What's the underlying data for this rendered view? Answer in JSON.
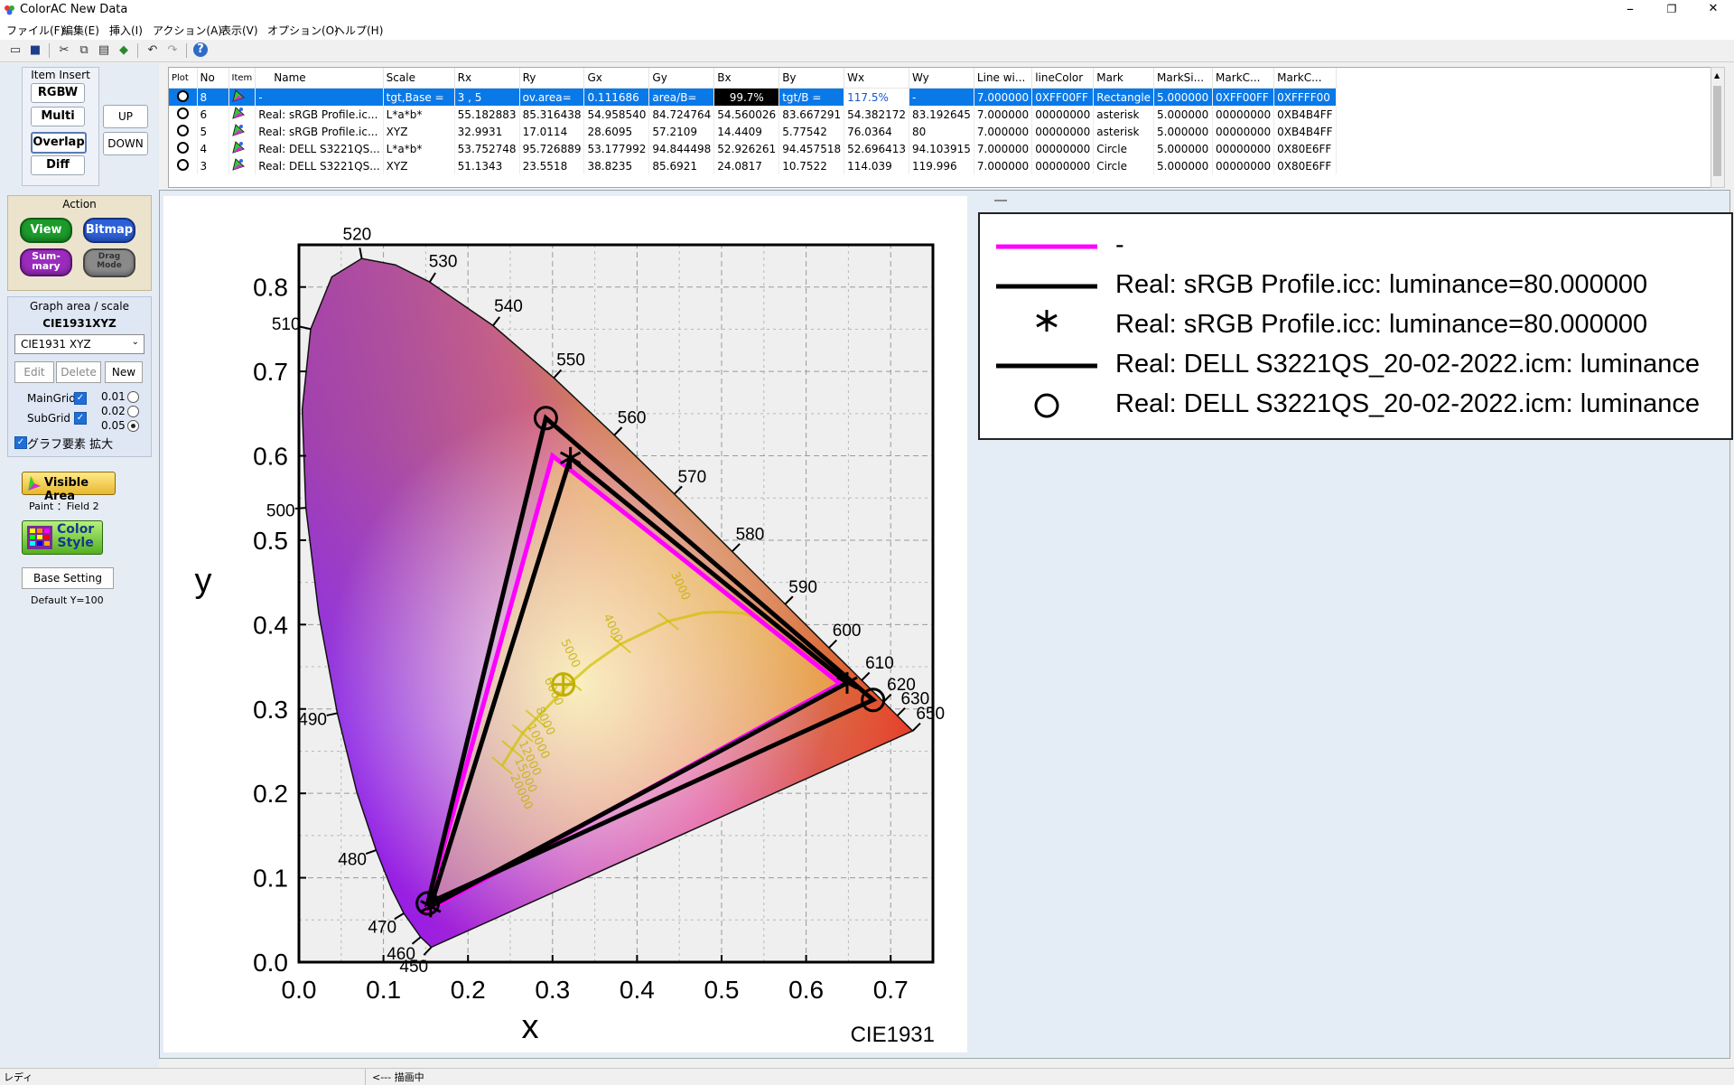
{
  "app": {
    "title": "ColorAC  New Data",
    "icon_letters": "AC"
  },
  "window_buttons": {
    "minimize": "–",
    "maximize": "❐",
    "close": "✕"
  },
  "menu": [
    "ファイル(F)",
    "編集(E)",
    "挿入(I)",
    "アクション(A)",
    "表示(V)",
    "オプション(O)",
    "ヘルプ(H)"
  ],
  "left": {
    "item_insert": {
      "title": "Item Insert",
      "rgbw": "RGBW",
      "multi": "Multi",
      "overlap": "Overlap",
      "diff": "Diff",
      "up": "UP",
      "down": "DOWN"
    },
    "action": {
      "title": "Action",
      "view": "View",
      "bitmap": "Bitmap",
      "summary_1": "Sum-",
      "summary_2": "mary",
      "drag_1": "Drag",
      "drag_2": "Mode"
    },
    "graph": {
      "title": "Graph area / scale",
      "current": "CIE1931XYZ",
      "select_value": "CIE1931 XYZ",
      "edit": "Edit",
      "delete": "Delete",
      "new": "New",
      "maingrid": "MainGrid",
      "subgrid": "SubGrid",
      "opt1": "0.01",
      "opt2": "0.02",
      "opt3": "0.05",
      "enlarge": "グラフ要素 拡大"
    },
    "visible_area": "Visible Area",
    "paint": "Paint ：Field 2",
    "color_style_1": "Color",
    "color_style_2": "Style",
    "base_setting": "Base Setting",
    "default_y": "Default Y=100"
  },
  "table": {
    "headers": [
      "Plot",
      "No",
      "Item",
      "Name",
      "Scale",
      "Rx",
      "Ry",
      "Gx",
      "Gy",
      "Bx",
      "By",
      "Wx",
      "Wy",
      "Line wi...",
      "lineColor",
      "Mark",
      "MarkSi...",
      "MarkC...",
      "MarkC..."
    ],
    "rows": [
      [
        "",
        "8",
        "",
        "-",
        "tgt,Base =",
        "3 , 5",
        "ov.area=",
        "0.111686",
        "area/B=",
        "99.7%",
        "tgt/B =",
        "117.5%",
        "-",
        "7.000000",
        "0XFF00FF",
        "Rectangle",
        "5.000000",
        "0XFF00FF",
        "0XFFFF00"
      ],
      [
        "",
        "6",
        "",
        "Real: sRGB Profile.ic...",
        "L*a*b*",
        "55.182883",
        "85.316438",
        "54.958540",
        "84.724764",
        "54.560026",
        "83.667291",
        "54.382172",
        "83.192645",
        "7.000000",
        "00000000",
        "asterisk",
        "5.000000",
        "00000000",
        "0XB4B4FF"
      ],
      [
        "",
        "5",
        "",
        "Real: sRGB Profile.ic...",
        "XYZ",
        "32.9931",
        "17.0114",
        "28.6095",
        "57.2109",
        "14.4409",
        "5.77542",
        "76.0364",
        "80",
        "7.000000",
        "00000000",
        "asterisk",
        "5.000000",
        "00000000",
        "0XB4B4FF"
      ],
      [
        "",
        "4",
        "",
        "Real: DELL S3221QS...",
        "L*a*b*",
        "53.752748",
        "95.726889",
        "53.177992",
        "94.844498",
        "52.926261",
        "94.457518",
        "52.696413",
        "94.103915",
        "7.000000",
        "00000000",
        "Circle",
        "5.000000",
        "00000000",
        "0X80E6FF"
      ],
      [
        "",
        "3",
        "",
        "Real: DELL S3221QS...",
        "XYZ",
        "51.1343",
        "23.5518",
        "38.8235",
        "85.6921",
        "24.0817",
        "10.7522",
        "114.039",
        "119.996",
        "7.000000",
        "00000000",
        "Circle",
        "5.000000",
        "00000000",
        "0X80E6FF"
      ]
    ]
  },
  "legend": {
    "entries": [
      {
        "text": "-",
        "color": "#ff00ff",
        "marker": "line"
      },
      {
        "text": "Real: sRGB Profile.icc: luminance=80.000000",
        "color": "#000000",
        "marker": "line"
      },
      {
        "text": "Real: sRGB Profile.icc: luminance=80.000000",
        "color": "#000000",
        "marker": "asterisk"
      },
      {
        "text": "Real: DELL S3221QS_20-02-2022.icm: luminance",
        "color": "#000000",
        "marker": "line"
      },
      {
        "text": "Real: DELL S3221QS_20-02-2022.icm: luminance",
        "color": "#000000",
        "marker": "circle"
      }
    ]
  },
  "status": {
    "left": "レディ",
    "right": "<--- 描画中"
  },
  "chart_data": {
    "type": "scatter",
    "caption": "CIE1931",
    "xlabel": "x",
    "ylabel": "y",
    "xlim": [
      0.0,
      0.75
    ],
    "ylim": [
      0.0,
      0.85
    ],
    "xticks": [
      "0.0",
      "0.1",
      "0.2",
      "0.3",
      "0.4",
      "0.5",
      "0.6",
      "0.7"
    ],
    "yticks": [
      "0.0",
      "0.1",
      "0.2",
      "0.3",
      "0.4",
      "0.5",
      "0.6",
      "0.7",
      "0.8"
    ],
    "grid": true,
    "spectral_locus": [
      {
        "nm": 450,
        "x": 0.1566,
        "y": 0.0177
      },
      {
        "nm": 460,
        "x": 0.144,
        "y": 0.0297
      },
      {
        "nm": 470,
        "x": 0.1241,
        "y": 0.0578
      },
      {
        "nm": 475,
        "x": 0.1096,
        "y": 0.0868
      },
      {
        "nm": 480,
        "x": 0.0913,
        "y": 0.1327
      },
      {
        "nm": 485,
        "x": 0.0687,
        "y": 0.2007
      },
      {
        "nm": 490,
        "x": 0.0454,
        "y": 0.295
      },
      {
        "nm": 495,
        "x": 0.0235,
        "y": 0.4127
      },
      {
        "nm": 500,
        "x": 0.0082,
        "y": 0.5384
      },
      {
        "nm": 505,
        "x": 0.0039,
        "y": 0.6548
      },
      {
        "nm": 510,
        "x": 0.0139,
        "y": 0.7502
      },
      {
        "nm": 515,
        "x": 0.0389,
        "y": 0.812
      },
      {
        "nm": 520,
        "x": 0.0743,
        "y": 0.8338
      },
      {
        "nm": 525,
        "x": 0.1142,
        "y": 0.8262
      },
      {
        "nm": 530,
        "x": 0.1547,
        "y": 0.8059
      },
      {
        "nm": 540,
        "x": 0.2296,
        "y": 0.7543
      },
      {
        "nm": 550,
        "x": 0.3016,
        "y": 0.6923
      },
      {
        "nm": 560,
        "x": 0.3731,
        "y": 0.6245
      },
      {
        "nm": 570,
        "x": 0.4441,
        "y": 0.5547
      },
      {
        "nm": 580,
        "x": 0.5125,
        "y": 0.4866
      },
      {
        "nm": 590,
        "x": 0.5752,
        "y": 0.4242
      },
      {
        "nm": 600,
        "x": 0.627,
        "y": 0.3725
      },
      {
        "nm": 610,
        "x": 0.6658,
        "y": 0.334
      },
      {
        "nm": 620,
        "x": 0.6915,
        "y": 0.3083
      },
      {
        "nm": 630,
        "x": 0.7079,
        "y": 0.292
      },
      {
        "nm": 650,
        "x": 0.726,
        "y": 0.274
      }
    ],
    "wavelength_labels": [
      450,
      460,
      470,
      480,
      490,
      500,
      510,
      520,
      530,
      540,
      550,
      560,
      570,
      580,
      590,
      600,
      610,
      620,
      630,
      650
    ],
    "cct_labels": [
      "3000",
      "4000",
      "5000",
      "6000",
      "8000",
      "10000",
      "12000",
      "15000",
      "20000"
    ],
    "white_point": {
      "x": 0.3127,
      "y": 0.329
    },
    "series": [
      {
        "name": "-",
        "color": "#ff00ff",
        "marker": "none",
        "points": [
          {
            "x": 0.64,
            "y": 0.33
          },
          {
            "x": 0.3,
            "y": 0.6
          },
          {
            "x": 0.15,
            "y": 0.06
          }
        ]
      },
      {
        "name": "Real: sRGB Profile.icc: luminance=80.000000",
        "color": "#000000",
        "marker": "asterisk",
        "points": [
          {
            "x": 0.6485,
            "y": 0.3309
          },
          {
            "x": 0.3212,
            "y": 0.5975
          },
          {
            "x": 0.1558,
            "y": 0.0661
          }
        ]
      },
      {
        "name": "Real: DELL S3221QS_20-02-2022.icm: luminance",
        "color": "#000000",
        "marker": "circle",
        "points": [
          {
            "x": 0.6792,
            "y": 0.3107
          },
          {
            "x": 0.2921,
            "y": 0.6447
          },
          {
            "x": 0.1524,
            "y": 0.0697
          }
        ]
      }
    ]
  }
}
